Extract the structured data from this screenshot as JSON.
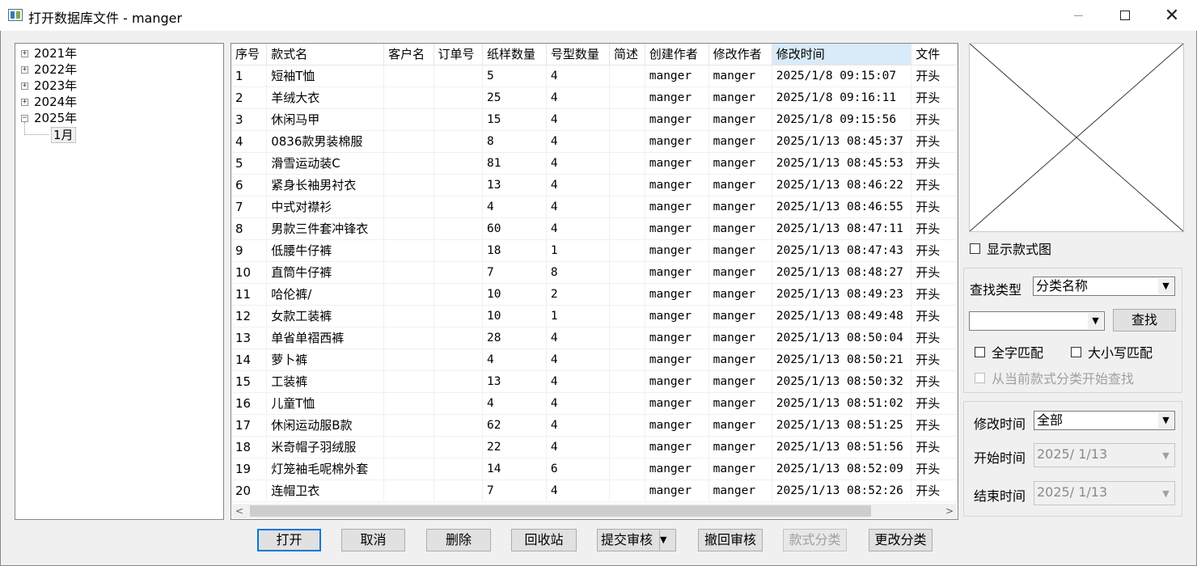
{
  "window": {
    "title": "打开数据库文件 - manger",
    "minimize_glyph": "—",
    "close_glyph": "✕"
  },
  "tree": {
    "items": [
      {
        "label": "2021年",
        "expander": "+"
      },
      {
        "label": "2022年",
        "expander": "+"
      },
      {
        "label": "2023年",
        "expander": "+"
      },
      {
        "label": "2024年",
        "expander": "+"
      },
      {
        "label": "2025年",
        "expander": "−"
      }
    ],
    "child": "1月"
  },
  "grid": {
    "columns": [
      "序号",
      "款式名",
      "客户名",
      "订单号",
      "纸样数量",
      "号型数量",
      "简述",
      "创建作者",
      "修改作者",
      "修改时间",
      "文件"
    ],
    "rows": [
      [
        "1",
        "短袖T恤",
        "",
        "",
        "5",
        "4",
        "",
        "manger",
        "manger",
        "2025/1/8 09:15:07",
        "开头"
      ],
      [
        "2",
        "羊绒大衣",
        "",
        "",
        "25",
        "4",
        "",
        "manger",
        "manger",
        "2025/1/8 09:16:11",
        "开头"
      ],
      [
        "3",
        "休闲马甲",
        "",
        "",
        "15",
        "4",
        "",
        "manger",
        "manger",
        "2025/1/8 09:15:56",
        "开头"
      ],
      [
        "4",
        "0836款男装棉服",
        "",
        "",
        "8",
        "4",
        "",
        "manger",
        "manger",
        "2025/1/13 08:45:37",
        "开头"
      ],
      [
        "5",
        "滑雪运动装C",
        "",
        "",
        "81",
        "4",
        "",
        "manger",
        "manger",
        "2025/1/13 08:45:53",
        "开头"
      ],
      [
        "6",
        "紧身长袖男衬衣",
        "",
        "",
        "13",
        "4",
        "",
        "manger",
        "manger",
        "2025/1/13 08:46:22",
        "开头"
      ],
      [
        "7",
        "中式对襟衫",
        "",
        "",
        "4",
        "4",
        "",
        "manger",
        "manger",
        "2025/1/13 08:46:55",
        "开头"
      ],
      [
        "8",
        "男款三件套冲锋衣",
        "",
        "",
        "60",
        "4",
        "",
        "manger",
        "manger",
        "2025/1/13 08:47:11",
        "开头"
      ],
      [
        "9",
        "低腰牛仔裤",
        "",
        "",
        "18",
        "1",
        "",
        "manger",
        "manger",
        "2025/1/13 08:47:43",
        "开头"
      ],
      [
        "10",
        "直筒牛仔裤",
        "",
        "",
        "7",
        "8",
        "",
        "manger",
        "manger",
        "2025/1/13 08:48:27",
        "开头"
      ],
      [
        "11",
        "哈伦裤/",
        "",
        "",
        "10",
        "2",
        "",
        "manger",
        "manger",
        "2025/1/13 08:49:23",
        "开头"
      ],
      [
        "12",
        "女款工装裤",
        "",
        "",
        "10",
        "1",
        "",
        "manger",
        "manger",
        "2025/1/13 08:49:48",
        "开头"
      ],
      [
        "13",
        "单省单褶西裤",
        "",
        "",
        "28",
        "4",
        "",
        "manger",
        "manger",
        "2025/1/13 08:50:04",
        "开头"
      ],
      [
        "14",
        "萝卜裤",
        "",
        "",
        "4",
        "4",
        "",
        "manger",
        "manger",
        "2025/1/13 08:50:21",
        "开头"
      ],
      [
        "15",
        "工装裤",
        "",
        "",
        "13",
        "4",
        "",
        "manger",
        "manger",
        "2025/1/13 08:50:32",
        "开头"
      ],
      [
        "16",
        "儿童T恤",
        "",
        "",
        "4",
        "4",
        "",
        "manger",
        "manger",
        "2025/1/13 08:51:02",
        "开头"
      ],
      [
        "17",
        "休闲运动服B款",
        "",
        "",
        "62",
        "4",
        "",
        "manger",
        "manger",
        "2025/1/13 08:51:25",
        "开头"
      ],
      [
        "18",
        "米奇帽子羽绒服",
        "",
        "",
        "22",
        "4",
        "",
        "manger",
        "manger",
        "2025/1/13 08:51:56",
        "开头"
      ],
      [
        "19",
        "灯笼袖毛呢棉外套",
        "",
        "",
        "14",
        "6",
        "",
        "manger",
        "manger",
        "2025/1/13 08:52:09",
        "开头"
      ],
      [
        "20",
        "连帽卫衣",
        "",
        "",
        "7",
        "4",
        "",
        "manger",
        "manger",
        "2025/1/13 08:52:26",
        "开头"
      ]
    ]
  },
  "preview": {
    "show_style_label": "显示款式图"
  },
  "search": {
    "type_label": "查找类型",
    "type_value": "分类名称",
    "query_value": "",
    "find_button": "查找",
    "whole_word_label": "全字匹配",
    "case_label": "大小写匹配",
    "from_current_label": "从当前款式分类开始查找"
  },
  "filter": {
    "modify_time_label": "修改时间",
    "modify_time_value": "全部",
    "start_label": "开始时间",
    "start_value": "2025/ 1/13",
    "end_label": "结束时间",
    "end_value": "2025/ 1/13"
  },
  "buttons": {
    "open": "打开",
    "cancel": "取消",
    "delete": "删除",
    "recycle": "回收站",
    "submit_review": "提交审核",
    "withdraw_review": "撤回审核",
    "style_category": "款式分类",
    "change_category": "更改分类"
  },
  "glyphs": {
    "dropdown": "▼",
    "scroll_left": "<",
    "scroll_right": ">"
  }
}
